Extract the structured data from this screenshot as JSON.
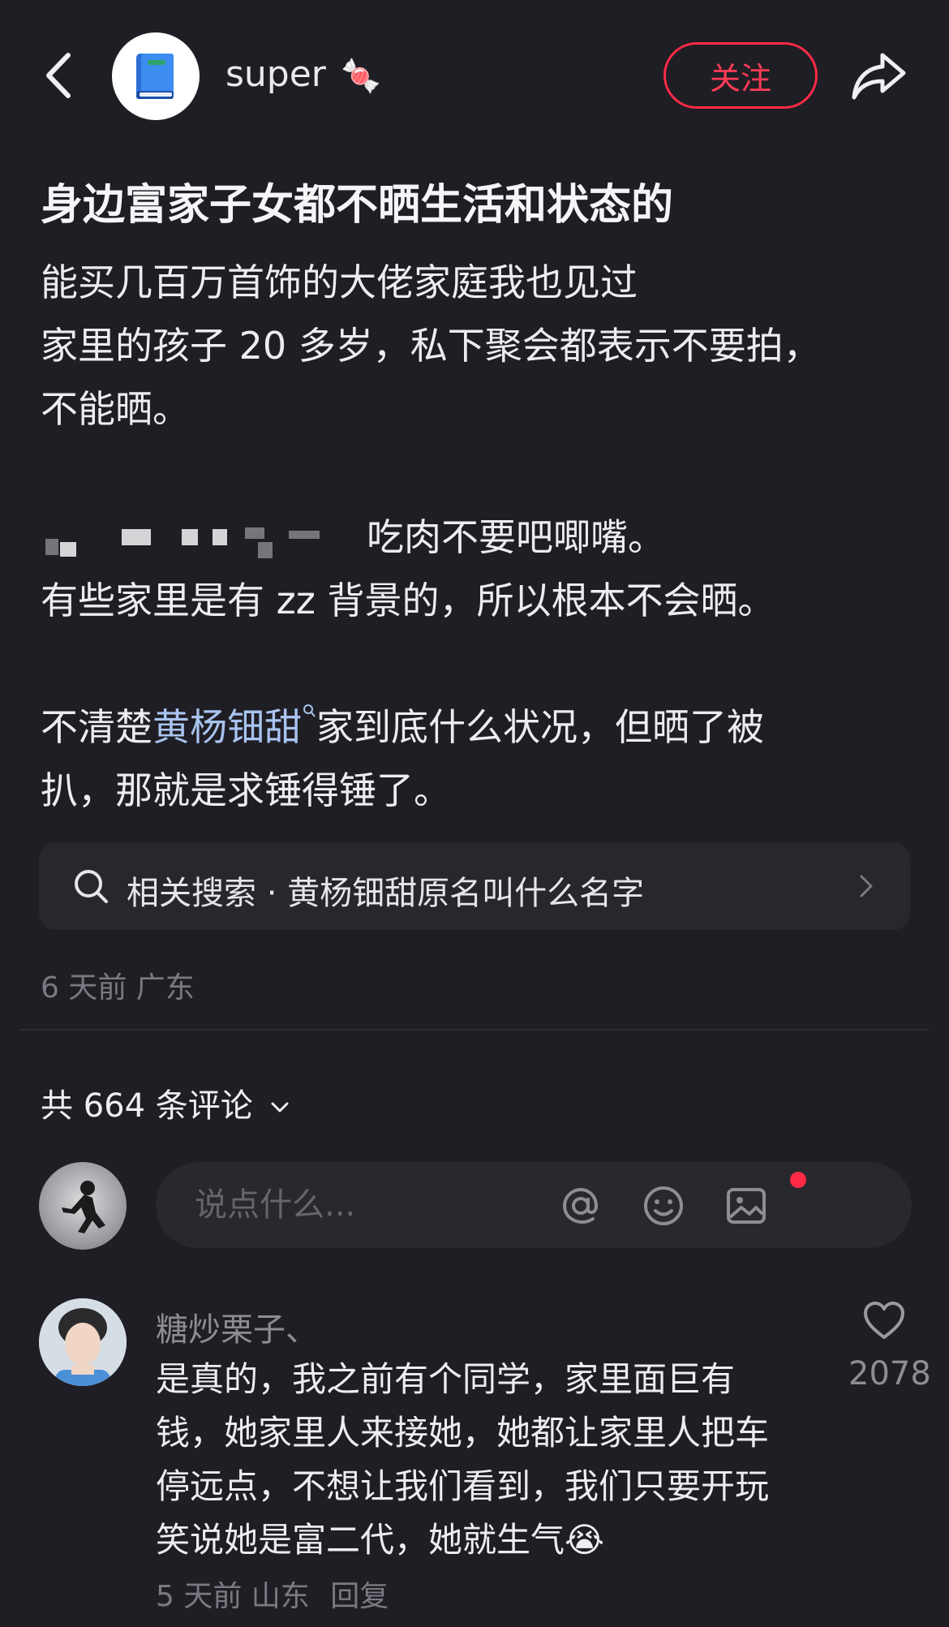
{
  "header": {
    "username": "super",
    "username_emoji": "🍬",
    "follow_label": "关注",
    "icons": {
      "back": "chevron-left-icon",
      "avatar": "blue-book-icon",
      "share": "share-arrow-icon"
    },
    "colors": {
      "follow": "#ff2a46",
      "background": "#1f1e24"
    }
  },
  "post": {
    "title": "身边富家子女都不晒生活和状态的",
    "lines": [
      "能买几百万首饰的大佬家庭我也见过",
      "家里的孩子 20 多岁，私下聚会都表示不要拍，",
      "不能晒。",
      "吃肉不要吧唧嘴。",
      "有些家里是有 zz 背景的，所以根本不会晒。"
    ],
    "para3_before_link": "不清楚",
    "para3_link": "黄杨钿甜",
    "para3_after_link": "家到底什么状况，但晒了被",
    "para3_line2": "扒，那就是求锤得锤了。",
    "link_icon": "search-icon"
  },
  "related_search": {
    "text": "相关搜索 · 黄杨钿甜原名叫什么名字",
    "icons": {
      "left": "search-icon",
      "right": "chevron-right-icon"
    }
  },
  "post_meta": "6 天前 广东",
  "comments_header": {
    "label": "共 664 条评论",
    "icon": "chevron-down-icon"
  },
  "comment_input": {
    "placeholder": "说点什么...",
    "icons": [
      "at-icon",
      "emoji-icon",
      "image-icon"
    ]
  },
  "comments": [
    {
      "username": "糖炒栗子、",
      "lines": [
        "是真的，我之前有个同学，家里面巨有",
        "钱，她家里人来接她，她都让家里人把车",
        "停远点，不想让我们看到，我们只要开玩",
        "笑说她是富二代，她就生气"
      ],
      "emoji": "😭",
      "meta": "5 天前 山东",
      "reply_label": "回复",
      "likes": "2078"
    }
  ]
}
